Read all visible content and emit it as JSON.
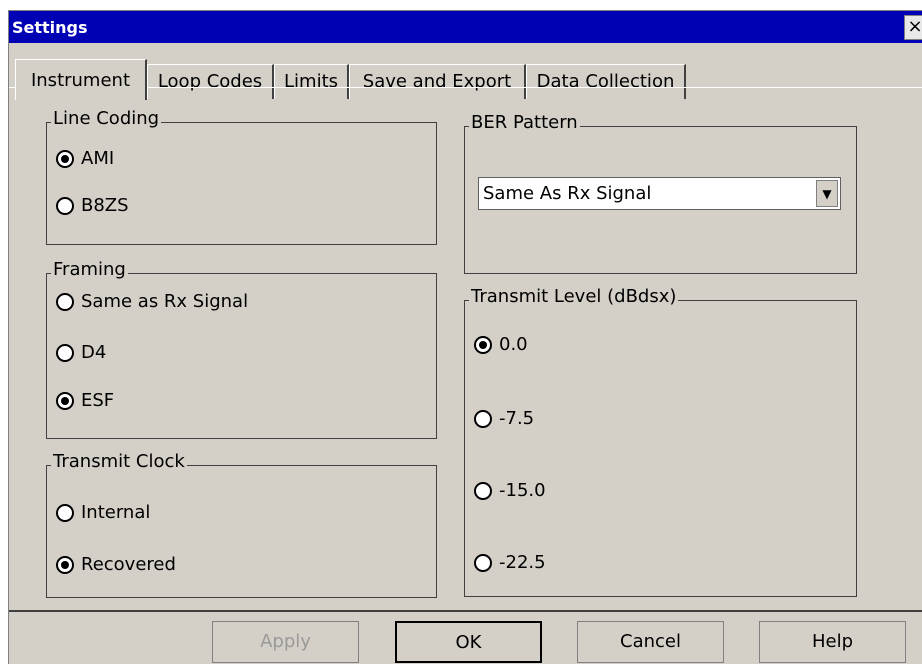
{
  "window": {
    "title": "Settings",
    "close_label": "×"
  },
  "tabs": [
    {
      "label": "Instrument",
      "active": true
    },
    {
      "label": "Loop Codes"
    },
    {
      "label": "Limits"
    },
    {
      "label": "Save and Export"
    },
    {
      "label": "Data Collection"
    }
  ],
  "line_coding": {
    "label": "Line Coding",
    "options": [
      {
        "label": "AMI",
        "selected": true
      },
      {
        "label": "B8ZS",
        "selected": false
      }
    ]
  },
  "framing": {
    "label": "Framing",
    "options": [
      {
        "label": "Same as Rx Signal",
        "selected": false
      },
      {
        "label": "D4",
        "selected": false
      },
      {
        "label": "ESF",
        "selected": true
      }
    ]
  },
  "transmit_clock": {
    "label": "Transmit Clock",
    "options": [
      {
        "label": "Internal",
        "selected": false
      },
      {
        "label": "Recovered",
        "selected": true
      }
    ]
  },
  "ber_pattern": {
    "label": "BER Pattern",
    "value": "Same As Rx Signal",
    "arrow": "▼"
  },
  "transmit_level": {
    "label": "Transmit Level (dBdsx)",
    "options": [
      {
        "label": "0.0",
        "selected": true
      },
      {
        "label": "-7.5",
        "selected": false
      },
      {
        "label": "-15.0",
        "selected": false
      },
      {
        "label": "-22.5",
        "selected": false
      }
    ]
  },
  "buttons": {
    "apply": "Apply",
    "ok": "OK",
    "cancel": "Cancel",
    "help": "Help"
  }
}
